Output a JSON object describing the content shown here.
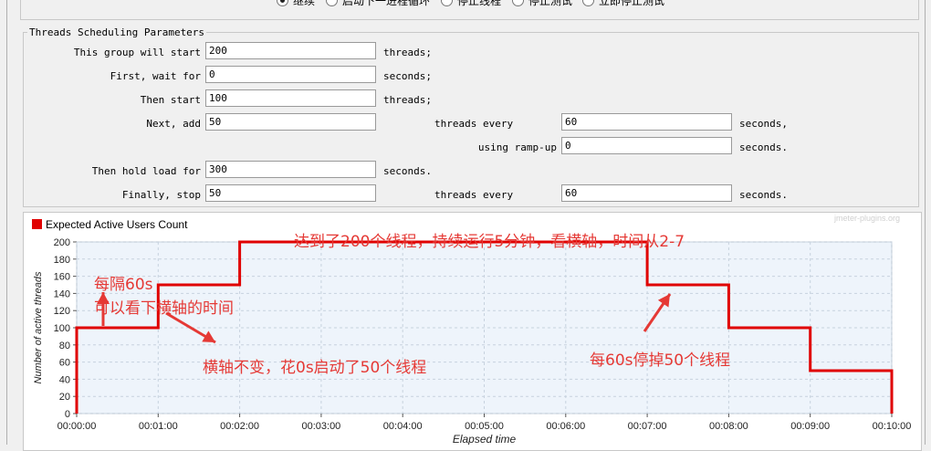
{
  "top_radio": {
    "options": [
      {
        "label": "继续",
        "selected": true
      },
      {
        "label": "启动下一进程循环",
        "selected": false
      },
      {
        "label": "停止线程",
        "selected": false
      },
      {
        "label": "停止测试",
        "selected": false
      },
      {
        "label": "立即停止测试",
        "selected": false
      }
    ]
  },
  "threads_panel": {
    "title": "Threads Scheduling Parameters",
    "start_label": "This group will start",
    "start_value": "200",
    "start_unit": "threads;",
    "wait_label": "First, wait for",
    "wait_value": "0",
    "wait_unit": "seconds;",
    "then_label": "Then start",
    "then_value": "100",
    "then_unit": "threads;",
    "next_label": "Next, add",
    "next_value": "50",
    "next_every_label": "threads every",
    "next_every_value": "60",
    "next_every_unit": "seconds,",
    "rampup_label": "using ramp-up",
    "rampup_value": "0",
    "rampup_unit": "seconds.",
    "hold_label": "Then hold load for",
    "hold_value": "300",
    "hold_unit": "seconds.",
    "stop_label": "Finally, stop",
    "stop_value": "50",
    "stop_every_label": "threads every",
    "stop_every_value": "60",
    "stop_every_unit": "seconds."
  },
  "chart": {
    "legend": "Expected Active Users Count",
    "watermark": "jmeter-plugins.org",
    "line_color": "#e00000"
  },
  "chart_data": {
    "type": "line",
    "xlabel": "Elapsed time",
    "ylabel": "Number of active threads",
    "x_ticks": [
      "00:00:00",
      "00:01:00",
      "00:02:00",
      "00:03:00",
      "00:04:00",
      "00:05:00",
      "00:06:00",
      "00:07:00",
      "00:08:00",
      "00:09:00",
      "00:10:00"
    ],
    "y_ticks": [
      "0",
      "20",
      "40",
      "60",
      "80",
      "100",
      "120",
      "140",
      "160",
      "180",
      "200"
    ],
    "ylim": [
      0,
      200
    ],
    "xlim_seconds": [
      0,
      600
    ],
    "grid": true,
    "series": [
      {
        "name": "Expected Active Users Count",
        "points": [
          [
            0,
            0
          ],
          [
            0,
            100
          ],
          [
            60,
            100
          ],
          [
            60,
            150
          ],
          [
            120,
            150
          ],
          [
            120,
            200
          ],
          [
            420,
            200
          ],
          [
            420,
            150
          ],
          [
            480,
            150
          ],
          [
            480,
            100
          ],
          [
            540,
            100
          ],
          [
            540,
            50
          ],
          [
            600,
            50
          ],
          [
            600,
            0
          ]
        ]
      }
    ]
  },
  "annotations": {
    "a1": "达到了200个线程，持续运行5分钟，看横轴，时间从2-7",
    "a2": "每隔60s",
    "a3": "可以看下横轴的时间",
    "a4": "横轴不变，花0s启动了50个线程",
    "a5": "每60s停掉50个线程",
    "color": "#e53935"
  }
}
